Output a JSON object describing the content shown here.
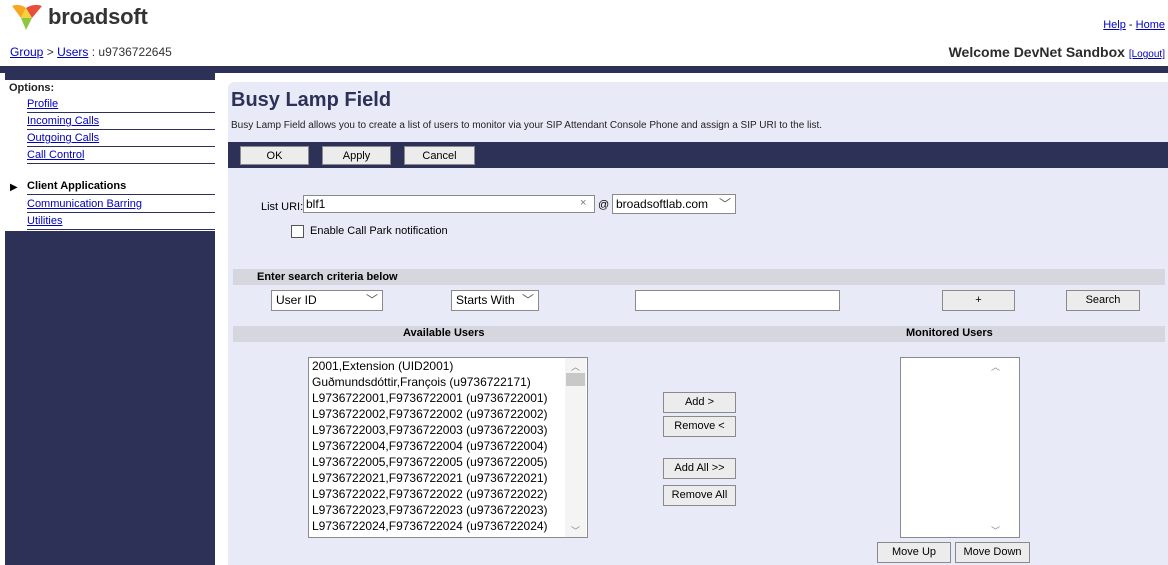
{
  "header": {
    "logo_text": "broadsoft",
    "breadcrumb": {
      "group": "Group",
      "sep1": ">",
      "users": "Users",
      "sep2": ": u9736722645"
    },
    "links": {
      "help": "Help",
      "sep": "-",
      "home": "Home"
    },
    "welcome": "Welcome DevNet Sandbox",
    "logout": "[Logout]"
  },
  "sidebar": {
    "title": "Options:",
    "items": [
      {
        "label": "Profile"
      },
      {
        "label": "Incoming Calls"
      },
      {
        "label": "Outgoing Calls"
      },
      {
        "label": "Call Control"
      },
      {
        "label": "Client Applications"
      },
      {
        "label": "Communication Barring"
      },
      {
        "label": "Utilities"
      }
    ],
    "active_bullet": "▶"
  },
  "main": {
    "title": "Busy Lamp Field",
    "description": "Busy Lamp Field allows you to create a list of users to monitor via your SIP Attendant Console Phone and assign a SIP URI to the list.",
    "buttons": {
      "ok": "OK",
      "apply": "Apply",
      "cancel": "Cancel"
    },
    "list_uri_label": "List URI: sip:",
    "list_uri_value": "blf1",
    "clear_icon": "×",
    "at": "@",
    "domain": "broadsoftlab.com",
    "call_park_label": "Enable Call Park notification",
    "call_park_checked": false
  },
  "search": {
    "header": "Enter search criteria below",
    "field": "User ID",
    "mode": "Starts With",
    "value": "",
    "plus_label": "+",
    "search_label": "Search"
  },
  "available": {
    "header": "Available Users",
    "items": [
      "2001,Extension (UID2001)",
      "Guðmundsdóttir,François (u9736722171)",
      "L9736722001,F9736722001 (u9736722001)",
      "L9736722002,F9736722002 (u9736722002)",
      "L9736722003,F9736722003 (u9736722003)",
      "L9736722004,F9736722004 (u9736722004)",
      "L9736722005,F9736722005 (u9736722005)",
      "L9736722021,F9736722021 (u9736722021)",
      "L9736722022,F9736722022 (u9736722022)",
      "L9736722023,F9736722023 (u9736722023)",
      "L9736722024,F9736722024 (u9736722024)"
    ]
  },
  "transfer": {
    "add": "Add >",
    "remove": "Remove <",
    "add_all": "Add All >>",
    "remove_all": "Remove All"
  },
  "monitored": {
    "header": "Monitored Users",
    "items": [],
    "move_up": "Move Up",
    "move_down": "Move Down"
  },
  "colors": {
    "brand_navy": "#2d3157",
    "content_bg": "#e9eaf7",
    "link": "#0000c0"
  }
}
